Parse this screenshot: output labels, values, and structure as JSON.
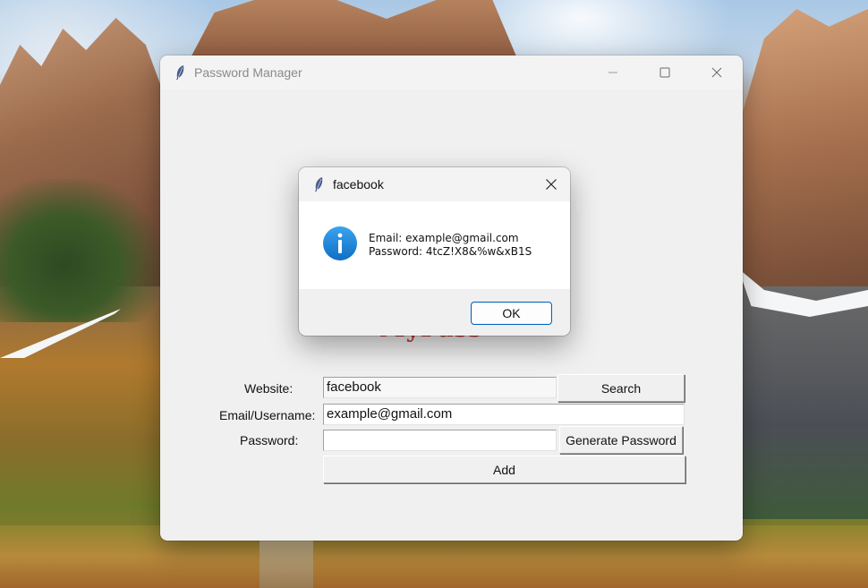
{
  "main_window": {
    "title": "Password Manager",
    "logo_text": "MyPass",
    "form": {
      "website_label": "Website:",
      "website_value": "facebook",
      "search_label": "Search",
      "email_label": "Email/Username:",
      "email_value": "example@gmail.com",
      "password_label": "Password:",
      "password_value": "",
      "generate_label": "Generate Password",
      "add_label": "Add"
    }
  },
  "dialog": {
    "title": "facebook",
    "message_line1": "Email: example@gmail.com",
    "message_line2": "Password: 4tcZ!X8&%w&xB1S",
    "ok_label": "OK",
    "icon": "info-icon"
  },
  "colors": {
    "accent": "#0067c0",
    "info_icon": "#1a86d6",
    "logo": "#c8312c"
  }
}
